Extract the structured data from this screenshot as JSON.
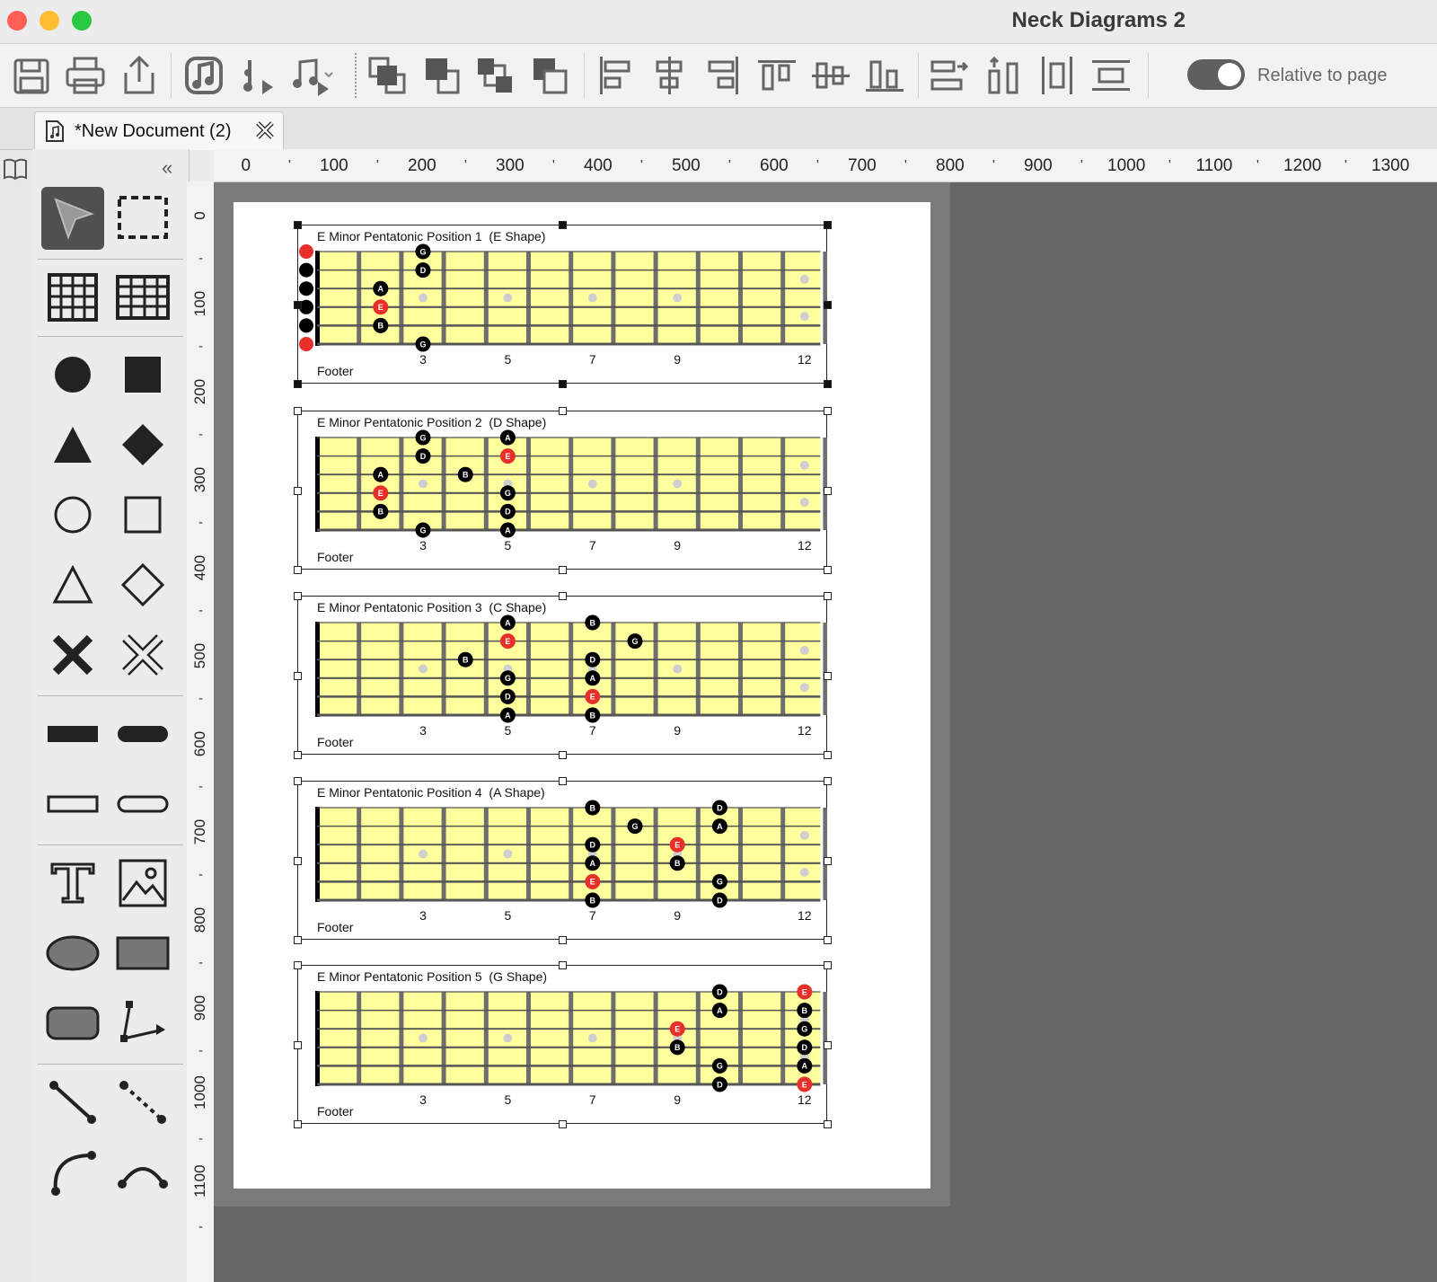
{
  "window": {
    "title": "Neck Diagrams 2"
  },
  "toolbar": {
    "buttons": [
      "save-icon",
      "print-icon",
      "share-icon",
      "insert-music-icon",
      "play-rhythm-icon",
      "play-melody-icon",
      "bring-to-front-icon",
      "bring-forward-icon",
      "send-backward-icon",
      "send-to-back-icon",
      "align-left-icon",
      "align-center-icon",
      "align-right-icon",
      "align-top-icon",
      "align-middle-icon",
      "align-bottom-icon",
      "distribute-horizontal-icon",
      "distribute-vertical-icon",
      "same-width-icon",
      "same-height-icon"
    ],
    "toggle_label": "Relative to page",
    "toggle_on": true
  },
  "tab": {
    "label": "*New Document (2)"
  },
  "panel": {
    "collapse_glyph": "«"
  },
  "ruler": {
    "h_labels": [
      "0",
      "100",
      "200",
      "300",
      "400",
      "500",
      "600",
      "700",
      "800",
      "900",
      "1000",
      "1100",
      "1200",
      "1300"
    ],
    "v_labels": [
      "0",
      "100",
      "200",
      "300",
      "400",
      "500",
      "600",
      "700",
      "800",
      "900",
      "1000",
      "1100"
    ]
  },
  "colors": {
    "fretboard": "#ffff9d",
    "fret": "#6e6e6e",
    "root_note": "#e8302a",
    "note": "#000000",
    "inlay": "#cfcfcf"
  },
  "neck": {
    "fret_labels": [
      "3",
      "5",
      "7",
      "9",
      "12"
    ]
  },
  "diagrams": [
    {
      "title": "E Minor Pentatonic Position 1  (E Shape)",
      "footer": "Footer",
      "open_strings": [
        {
          "s": 6,
          "root": true
        },
        {
          "s": 5,
          "root": false
        },
        {
          "s": 4,
          "root": false
        },
        {
          "s": 3,
          "root": false
        },
        {
          "s": 2,
          "root": false
        },
        {
          "s": 1,
          "root": true
        }
      ],
      "notes": [
        {
          "s": 1,
          "f": 3,
          "n": "G",
          "root": false
        },
        {
          "s": 2,
          "f": 3,
          "n": "D",
          "root": false
        },
        {
          "s": 3,
          "f": 2,
          "n": "A",
          "root": false
        },
        {
          "s": 4,
          "f": 2,
          "n": "E",
          "root": true
        },
        {
          "s": 5,
          "f": 2,
          "n": "B",
          "root": false
        },
        {
          "s": 6,
          "f": 3,
          "n": "G",
          "root": false
        }
      ]
    },
    {
      "title": "E Minor Pentatonic Position 2  (D Shape)",
      "footer": "Footer",
      "open_strings": [],
      "notes": [
        {
          "s": 1,
          "f": 3,
          "n": "G",
          "root": false
        },
        {
          "s": 1,
          "f": 5,
          "n": "A",
          "root": false
        },
        {
          "s": 2,
          "f": 3,
          "n": "D",
          "root": false
        },
        {
          "s": 2,
          "f": 5,
          "n": "E",
          "root": true
        },
        {
          "s": 3,
          "f": 2,
          "n": "A",
          "root": false
        },
        {
          "s": 3,
          "f": 4,
          "n": "B",
          "root": false
        },
        {
          "s": 4,
          "f": 2,
          "n": "E",
          "root": true
        },
        {
          "s": 4,
          "f": 5,
          "n": "G",
          "root": false
        },
        {
          "s": 5,
          "f": 2,
          "n": "B",
          "root": false
        },
        {
          "s": 5,
          "f": 5,
          "n": "D",
          "root": false
        },
        {
          "s": 6,
          "f": 3,
          "n": "G",
          "root": false
        },
        {
          "s": 6,
          "f": 5,
          "n": "A",
          "root": false
        }
      ]
    },
    {
      "title": "E Minor Pentatonic Position 3  (C Shape)",
      "footer": "Footer",
      "open_strings": [],
      "notes": [
        {
          "s": 1,
          "f": 5,
          "n": "A",
          "root": false
        },
        {
          "s": 1,
          "f": 7,
          "n": "B",
          "root": false
        },
        {
          "s": 2,
          "f": 5,
          "n": "E",
          "root": true
        },
        {
          "s": 2,
          "f": 8,
          "n": "G",
          "root": false
        },
        {
          "s": 3,
          "f": 4,
          "n": "B",
          "root": false
        },
        {
          "s": 3,
          "f": 7,
          "n": "D",
          "root": false
        },
        {
          "s": 4,
          "f": 5,
          "n": "G",
          "root": false
        },
        {
          "s": 4,
          "f": 7,
          "n": "A",
          "root": false
        },
        {
          "s": 5,
          "f": 5,
          "n": "D",
          "root": false
        },
        {
          "s": 5,
          "f": 7,
          "n": "E",
          "root": true
        },
        {
          "s": 6,
          "f": 5,
          "n": "A",
          "root": false
        },
        {
          "s": 6,
          "f": 7,
          "n": "B",
          "root": false
        }
      ]
    },
    {
      "title": "E Minor Pentatonic Position 4  (A Shape)",
      "footer": "Footer",
      "open_strings": [],
      "notes": [
        {
          "s": 1,
          "f": 7,
          "n": "B",
          "root": false
        },
        {
          "s": 1,
          "f": 10,
          "n": "D",
          "root": false
        },
        {
          "s": 2,
          "f": 8,
          "n": "G",
          "root": false
        },
        {
          "s": 2,
          "f": 10,
          "n": "A",
          "root": false
        },
        {
          "s": 3,
          "f": 7,
          "n": "D",
          "root": false
        },
        {
          "s": 3,
          "f": 9,
          "n": "E",
          "root": true
        },
        {
          "s": 4,
          "f": 7,
          "n": "A",
          "root": false
        },
        {
          "s": 4,
          "f": 9,
          "n": "B",
          "root": false
        },
        {
          "s": 5,
          "f": 7,
          "n": "E",
          "root": true
        },
        {
          "s": 5,
          "f": 10,
          "n": "G",
          "root": false
        },
        {
          "s": 6,
          "f": 7,
          "n": "B",
          "root": false
        },
        {
          "s": 6,
          "f": 10,
          "n": "D",
          "root": false
        }
      ]
    },
    {
      "title": "E Minor Pentatonic Position 5  (G Shape)",
      "footer": "Footer",
      "open_strings": [],
      "notes": [
        {
          "s": 1,
          "f": 10,
          "n": "D",
          "root": false
        },
        {
          "s": 1,
          "f": 12,
          "n": "E",
          "root": true
        },
        {
          "s": 2,
          "f": 10,
          "n": "A",
          "root": false
        },
        {
          "s": 2,
          "f": 12,
          "n": "B",
          "root": false
        },
        {
          "s": 3,
          "f": 9,
          "n": "E",
          "root": true
        },
        {
          "s": 3,
          "f": 12,
          "n": "G",
          "root": false
        },
        {
          "s": 4,
          "f": 9,
          "n": "B",
          "root": false
        },
        {
          "s": 4,
          "f": 12,
          "n": "D",
          "root": false
        },
        {
          "s": 5,
          "f": 10,
          "n": "G",
          "root": false
        },
        {
          "s": 5,
          "f": 12,
          "n": "A",
          "root": false
        },
        {
          "s": 6,
          "f": 10,
          "n": "D",
          "root": false
        },
        {
          "s": 6,
          "f": 12,
          "n": "E",
          "root": true
        }
      ]
    }
  ]
}
